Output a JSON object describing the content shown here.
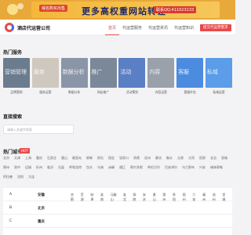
{
  "banner": {
    "tag": "域名购买出售",
    "main": "更多高权重网站转让",
    "qq": "联系QQ:411023133"
  },
  "header": {
    "logo_text": "酒店代运营公司",
    "nav": [
      "首页",
      "代运营服务",
      "代运营资讯",
      "代运营知识",
      "代运营问答"
    ],
    "submit_label": "提交代运营需求"
  },
  "hot_services": {
    "title": "热门服务",
    "items": [
      {
        "label": "品牌营销",
        "overlay": "营销管理",
        "color": "#6b7c8f"
      },
      {
        "label": "服务运营",
        "overlay": "服务",
        "color": "#cfc8bf"
      },
      {
        "label": "数据分析",
        "overlay": "数据分析",
        "color": "#8a96a8"
      },
      {
        "label": "网店推广",
        "overlay": "推广",
        "color": "#7a8899"
      },
      {
        "label": "活动策划",
        "overlay": "活动",
        "color": "#5b7fc4"
      },
      {
        "label": "内容运营",
        "overlay": "内容",
        "color": "#9aa1aa"
      },
      {
        "label": "客服外包",
        "overlay": "客服",
        "color": "#4c8ce0"
      },
      {
        "label": "私域运营",
        "overlay": "私域",
        "color": "#5b9de8"
      }
    ]
  },
  "direct_search": {
    "title": "直接搜索",
    "placeholder": "请输入关键字搜索"
  },
  "hot_cities": {
    "title": "热门城市",
    "badge": "HOT",
    "cities": [
      "北京",
      "天津",
      "上海",
      "重庆",
      "石家庄",
      "唐山",
      "秦皇岛",
      "邯郸",
      "邢台",
      "保定",
      "张家口",
      "承德",
      "沧州",
      "廊坊",
      "衡水",
      "太原",
      "大同",
      "阳泉",
      "长治",
      "晋城",
      "朔州",
      "晋中",
      "运城",
      "忻州",
      "临汾",
      "吕梁",
      "呼和浩特",
      "包头",
      "乌海",
      "赤峰",
      "通辽",
      "鄂尔多斯",
      "呼伦贝尔",
      "巴彦淖尔",
      "乌兰察布",
      "兴安",
      "锡林郭勒",
      "阿拉善",
      "沈阳",
      "大连"
    ]
  },
  "province_table": [
    {
      "letter": "A",
      "province": "安徽",
      "cities": [
        "合肥",
        "芜湖",
        "蚌埠",
        "淮南",
        "马鞍山",
        "淮北",
        "铜陵",
        "安庆",
        "黄山",
        "滁州",
        "阜阳",
        "宿州",
        "六安",
        "亳州",
        "池州",
        "宣城"
      ]
    },
    {
      "letter": "B",
      "province": "北京",
      "cities": []
    },
    {
      "letter": "C",
      "province": "重庆",
      "cities": []
    }
  ]
}
